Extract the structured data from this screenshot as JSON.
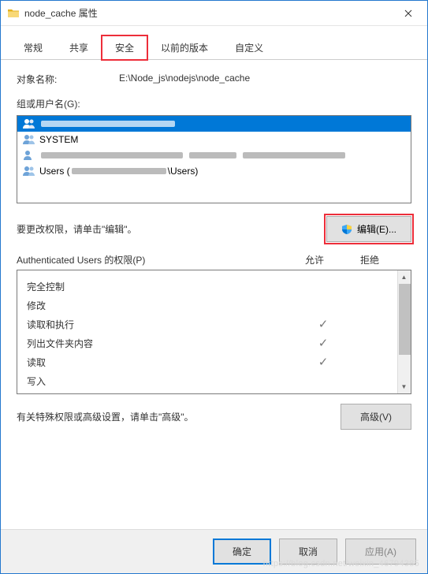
{
  "window": {
    "title": "node_cache 属性"
  },
  "tabs": {
    "general": "常规",
    "share": "共享",
    "security": "安全",
    "previous": "以前的版本",
    "custom": "自定义",
    "active": "security"
  },
  "object": {
    "label": "对象名称:",
    "path": "E:\\Node_js\\nodejs\\node_cache"
  },
  "groups": {
    "label": "组或用户名(G):",
    "item_system": "SYSTEM",
    "item_users_prefix": "Users (",
    "item_users_suffix": "\\Users)"
  },
  "edit": {
    "hint": "要更改权限，请单击\"编辑\"。",
    "button": "编辑(E)..."
  },
  "permissions": {
    "header_prefix": "Authenticated Users 的权限(P)",
    "col_allow": "允许",
    "col_deny": "拒绝",
    "rows": {
      "full": "完全控制",
      "modify": "修改",
      "read_exec": "读取和执行",
      "list": "列出文件夹内容",
      "read": "读取",
      "write": "写入"
    },
    "checks": {
      "read_exec": true,
      "list": true,
      "read": true
    }
  },
  "advanced": {
    "hint": "有关特殊权限或高级设置，请单击\"高级\"。",
    "button": "高级(V)"
  },
  "footer": {
    "ok": "确定",
    "cancel": "取消",
    "apply": "应用(A)"
  },
  "watermark": "https://blog.csdn.net/weixin_46794385"
}
